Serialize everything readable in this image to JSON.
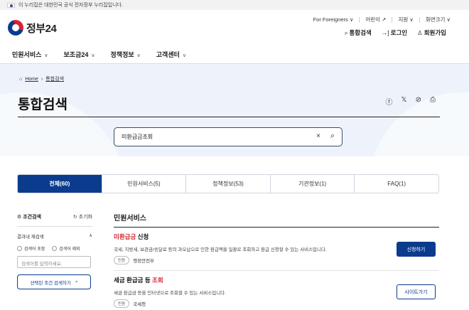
{
  "gov_banner": {
    "text": "이 누리집은 대한민국 공식 전자정부 누리집입니다."
  },
  "header": {
    "logo_text": "정부24",
    "util": [
      {
        "label": "For Foreigners ∨"
      },
      {
        "label": "어린이 ↗"
      },
      {
        "label": "지원 ∨"
      },
      {
        "label": "화면크기 ∨"
      }
    ],
    "actions": [
      {
        "icon": "search-icon",
        "glyph": "⌕",
        "label": "통합검색"
      },
      {
        "icon": "login-icon",
        "glyph": "→]",
        "label": "로그인"
      },
      {
        "icon": "user-icon",
        "glyph": "♙",
        "label": "회원가입"
      }
    ]
  },
  "nav": [
    "민원서비스",
    "보조금24",
    "정책정보",
    "고객센터"
  ],
  "breadcrumb": {
    "home": "Home",
    "current": "통합검색"
  },
  "page_title": "통합검색",
  "share_icons": [
    "facebook-icon",
    "x-icon",
    "link-icon",
    "print-icon"
  ],
  "search": {
    "value": "미환급금조회"
  },
  "tabs": [
    {
      "label": "전체(60)",
      "active": true
    },
    {
      "label": "민원서비스(5)"
    },
    {
      "label": "정책정보(53)"
    },
    {
      "label": "기관정보(1)"
    },
    {
      "label": "FAQ(1)"
    }
  ],
  "filter": {
    "title": "조건검색",
    "reset": "초기화",
    "refine_label": "결과내 재검색",
    "include": "검색어 포함",
    "exclude": "검색어 제외",
    "input_placeholder": "검색어를 입력하세요.",
    "button": "선택된 조건 검색하기"
  },
  "section_title": "민원서비스",
  "results": [
    {
      "title_hl": "미환급금",
      "title_rest": " 신청",
      "desc": "국세, 지방세, 보관금/송달료 등의 과오납으로 인한 환급액을 일괄로 조회하고 환급 신청할 수 있는 서비스입니다.",
      "chip": "민원",
      "org": "행정안전부",
      "button": "신청하기"
    },
    {
      "title_pre": "세금 환급금 등 ",
      "title_hl": "조회",
      "desc": "세금 환급금 등을 인터넷으로 조회할 수 있는 서비스입니다.",
      "chip": "민원",
      "org": "국세청",
      "button": "사이트가기"
    }
  ],
  "colors": {
    "primary": "#0b3b8c",
    "highlight": "#d6242f",
    "hero_bg": "#eef3fb"
  }
}
